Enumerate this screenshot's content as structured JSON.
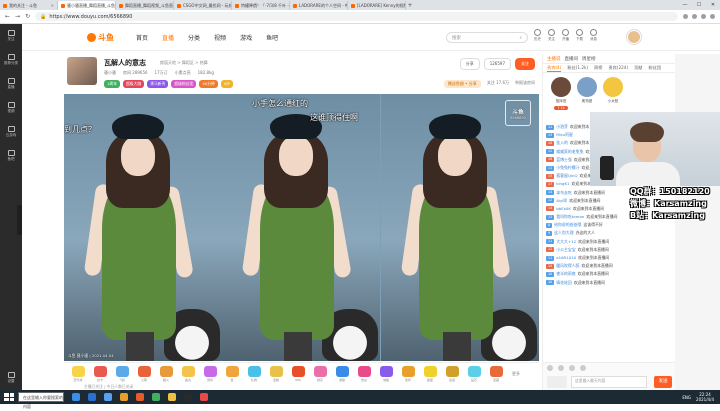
{
  "browser": {
    "tabs": [
      {
        "label": "我的关注 - 斗鱼",
        "active": false
      },
      {
        "label": "骚小骚直播_舞蹈直播_斗鱼",
        "active": true
      },
      {
        "label": "舞蹈直播_舞蹈视频_斗鱼直播",
        "active": false
      },
      {
        "label": "CSGO中文网_最优网 - 玩刻成为",
        "active": false
      },
      {
        "label": "特權降價！「-7/3/8 千叶 - bil",
        "active": false
      },
      {
        "label": "LADORARE的个人空间 - 哔哩",
        "active": false
      },
      {
        "label": "[LADORARE] Kenny的视频",
        "active": false
      }
    ],
    "new_tab": "+",
    "window_controls": [
      "—",
      "☐",
      "✕"
    ],
    "url": "https://www.douyu.com/6566890",
    "nav": {
      "back": "←",
      "forward": "→",
      "reload": "↻"
    }
  },
  "leftbar": {
    "items": [
      "关注",
      "推荐分类",
      "直播",
      "视频",
      "云游戏",
      "鱼吧"
    ],
    "bottom": "设置"
  },
  "topnav": {
    "logo": "斗鱼",
    "links": [
      "首页",
      "直播",
      "分类",
      "视频",
      "游戏",
      "鱼吧"
    ],
    "active_link": "直播",
    "search_placeholder": "搜索",
    "toplinks": [
      "历史",
      "关注",
      "开播",
      "下载",
      "消息"
    ]
  },
  "room": {
    "title": "瓦解人的意志",
    "tags": "颜值天地 > 舞蹈区 > 热舞",
    "meta": [
      "骚小骚",
      "房间 289656",
      "17万订",
      "小素点亮",
      "182.8kg"
    ],
    "badges": [
      "1周年",
      "超级大咖",
      "黑马新秀",
      "超级粉丝团",
      "40分钟",
      "VIP"
    ],
    "badge_colors": [
      "#40b060",
      "#e6455a",
      "#8a55e8",
      "#d855c8",
      "#f07a2a",
      "#f0b32a"
    ],
    "buttons": {
      "share": "分享",
      "report": "举报",
      "follow": "关注"
    },
    "follow_count": "126597",
    "sub": [
      "赠送鱼翅 • 分享",
      "关注 17.6万",
      "举报该房间"
    ]
  },
  "video": {
    "overlay_texts": [
      {
        "text": "到几点？",
        "style": "left:0;top:30px"
      },
      {
        "text": "小手怎么通红的",
        "style": "left:188px;top:4px"
      },
      {
        "text": "这谁顶得住啊",
        "style": "left:246px;top:18px"
      }
    ],
    "watermark": "斗鱼",
    "watermark_id": "6566890",
    "footer": "斗鱼 骚小骚 | 2021.04.04"
  },
  "gifts": [
    {
      "name": "荧光棒",
      "color": "#f7d34a"
    },
    {
      "name": "办卡",
      "color": "#e85a4f"
    },
    {
      "name": "飞机",
      "color": "#5aa9e8"
    },
    {
      "name": "火箭",
      "color": "#e8633a"
    },
    {
      "name": "超火",
      "color": "#e89a3a"
    },
    {
      "name": "鱼丸",
      "color": "#f3c34a"
    },
    {
      "name": "弱鸡",
      "color": "#c76ae8"
    },
    {
      "name": "赞",
      "color": "#f0a53a"
    },
    {
      "name": "礼物",
      "color": "#49c0e8"
    },
    {
      "name": "宝箱",
      "color": "#e8c04a"
    },
    {
      "name": "666",
      "color": "#e8502a"
    },
    {
      "name": "鲜花",
      "color": "#ea6fa8"
    },
    {
      "name": "游艇",
      "color": "#3a8ae8"
    },
    {
      "name": "告白",
      "color": "#e84a8a"
    },
    {
      "name": "城堡",
      "color": "#8a5ae8"
    },
    {
      "name": "奖杯",
      "color": "#e8a02a"
    },
    {
      "name": "星星",
      "color": "#f0d02a"
    },
    {
      "name": "皇冠",
      "color": "#d0a02a"
    },
    {
      "name": "钻石",
      "color": "#5ad0e8"
    },
    {
      "name": "宝藏",
      "color": "#e86a3a"
    }
  ],
  "gift_more": "更多",
  "gift_note": "主播已关注 | 今日人数已关闭",
  "right": {
    "tabs": [
      "主播说",
      "直播间",
      "周星榜"
    ],
    "tabs2": [
      "贵宾(4)",
      "粉丝(1.2k)",
      "周榜",
      "贵宾(224)",
      "贡献",
      "粉丝团"
    ],
    "ranks": [
      {
        "name": "指挥官",
        "badge": "7.1k",
        "color": "#6b4a3a"
      },
      {
        "name": "奥特曼",
        "badge": "",
        "color": "#7aa0c8"
      },
      {
        "name": "小太阳",
        "badge": "",
        "color": "#f3c640"
      }
    ],
    "chat": [
      {
        "lv": "11",
        "lvc": "#55a0e8",
        "name": "小泡芽",
        "msg": "欢迎来到本直播间"
      },
      {
        "lv": "13",
        "lvc": "#55a0e8",
        "name": "Misu阿星",
        "msg": ""
      },
      {
        "lv": "20",
        "lvc": "#e86a4a",
        "name": "挂入的",
        "msg": "欢迎来到本直播间"
      },
      {
        "lv": "12",
        "lvc": "#55a0e8",
        "name": "威威家的老兔兔",
        "msg": "欢迎来到本直播间"
      },
      {
        "lv": "16",
        "lvc": "#e86a4a",
        "name": "蓝博士强",
        "msg": "欢迎来到本直播间"
      },
      {
        "lv": "11",
        "lvc": "#55a0e8",
        "name": "小兔兔柠檬汁",
        "msg": "欢迎来到本直播间"
      },
      {
        "lv": "15",
        "lvc": "#e86a4a",
        "name": "孤客留QinQ",
        "msg": "欢迎来到本直播间"
      },
      {
        "lv": "17",
        "lvc": "#e86a4a",
        "name": "kingK1",
        "msg": "欢迎来到本直播间"
      },
      {
        "lv": "14",
        "lvc": "#55a0e8",
        "name": "拿鸟去吃",
        "msg": "欢迎来到本直播间"
      },
      {
        "lv": "12",
        "lvc": "#55a0e8",
        "name": "Aiyi咩",
        "msg": "欢迎来到本直播间"
      },
      {
        "lv": "14",
        "lvc": "#e86a4a",
        "name": "bbEk0K",
        "msg": "欢迎来到本直播间"
      },
      {
        "lv": "13",
        "lvc": "#55a0e8",
        "name": "我叫你吃toman",
        "msg": "欢迎来到本直播间"
      },
      {
        "lv": "8",
        "lvc": "#55a0e8",
        "name": "给你说的爸爸哦",
        "msg": "这该得不好"
      },
      {
        "lv": "9",
        "lvc": "#55a0e8",
        "name": "这人别大理",
        "msg": "办这的大人"
      },
      {
        "lv": "11",
        "lvc": "#55a0e8",
        "name": "大大大+12",
        "msg": "欢迎来到本直播间"
      },
      {
        "lv": "12",
        "lvc": "#e86a4a",
        "name": "小公主宝宝",
        "msg": "欢迎来到本直播间"
      },
      {
        "lv": "11",
        "lvc": "#55a0e8",
        "name": "a16R1010",
        "msg": "欢迎来到本直播间"
      },
      {
        "lv": "15",
        "lvc": "#e86a4a",
        "name": "暖风吹得人醉",
        "msg": "欢迎来到本直播间"
      },
      {
        "lv": "10",
        "lvc": "#55a0e8",
        "name": "夜半的雨夜",
        "msg": "欢迎来到本直播间"
      },
      {
        "lv": "10",
        "lvc": "#55a0e8",
        "name": "情花轮回",
        "msg": "欢迎来到本直播间"
      }
    ],
    "input_placeholder": "这里输入聊天内容",
    "send": "发送"
  },
  "webcam": {
    "lines": [
      "QQ群：150182120",
      "微博：Karsamzing",
      "B站：Karsamzing"
    ]
  },
  "taskbar": {
    "search": "在这里输入你要搜索的内容",
    "apps": [
      "#3a8ee8",
      "#2a6fd0",
      "#5aa0f0",
      "#e8a02a",
      "#e85a2a",
      "#40b060",
      "#f0c040",
      "#2a2a2a",
      "#e84a4a"
    ],
    "lang": "ENG",
    "time": "22:24",
    "date": "2021/4/4"
  }
}
